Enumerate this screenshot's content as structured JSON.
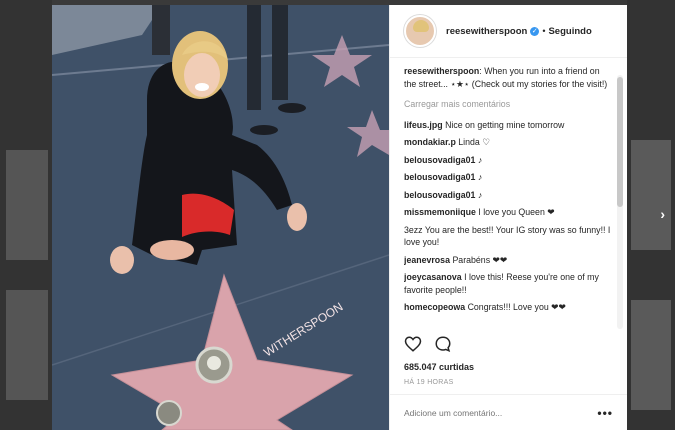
{
  "post": {
    "username": "reesewitherspoon",
    "follow_label": "Seguindo",
    "caption_user": "reesewitherspoon",
    "caption_text": "When you run into a friend on the street... ⋆★⋆ (Check out my stories for the visit!)",
    "load_more": "Carregar mais comentários",
    "comments": [
      {
        "user": "lifeus.jpg",
        "text": "Nice on getting mine tomorrow"
      },
      {
        "user": "mondakiar.p",
        "text": "Linda ♡"
      },
      {
        "user": "belousovadiga01",
        "text": "♪"
      },
      {
        "user": "belousovadiga01",
        "text": "♪"
      },
      {
        "user": "belousovadiga01",
        "text": "♪"
      },
      {
        "user": "missmemoniique",
        "text": "I love you Queen ❤"
      },
      {
        "user": "",
        "text": "3ezz You are the best!! Your IG story was so funny!! I love you!"
      },
      {
        "user": "jeanevrosa",
        "text": "Parabéns ❤❤"
      },
      {
        "user": "joeycasanova",
        "text": "I love this! Reese you're one of my favorite people!!"
      },
      {
        "user": "homecopeowa",
        "text": "Congrats!!! Love you ❤❤"
      }
    ],
    "likes": "685.047 curtidas",
    "time": "há 19 horas",
    "add_comment_placeholder": "Adicione um comentário...",
    "more_label": "•••",
    "star_name": "WITHERSPOON"
  },
  "colors": {
    "accent": "#3897f0",
    "star": "#d9a3ab",
    "sidewalk": "#3b4a5e"
  },
  "icons": {
    "heart": "heart-icon",
    "comment": "comment-icon",
    "more": "more-icon",
    "verified": "verified-icon"
  }
}
